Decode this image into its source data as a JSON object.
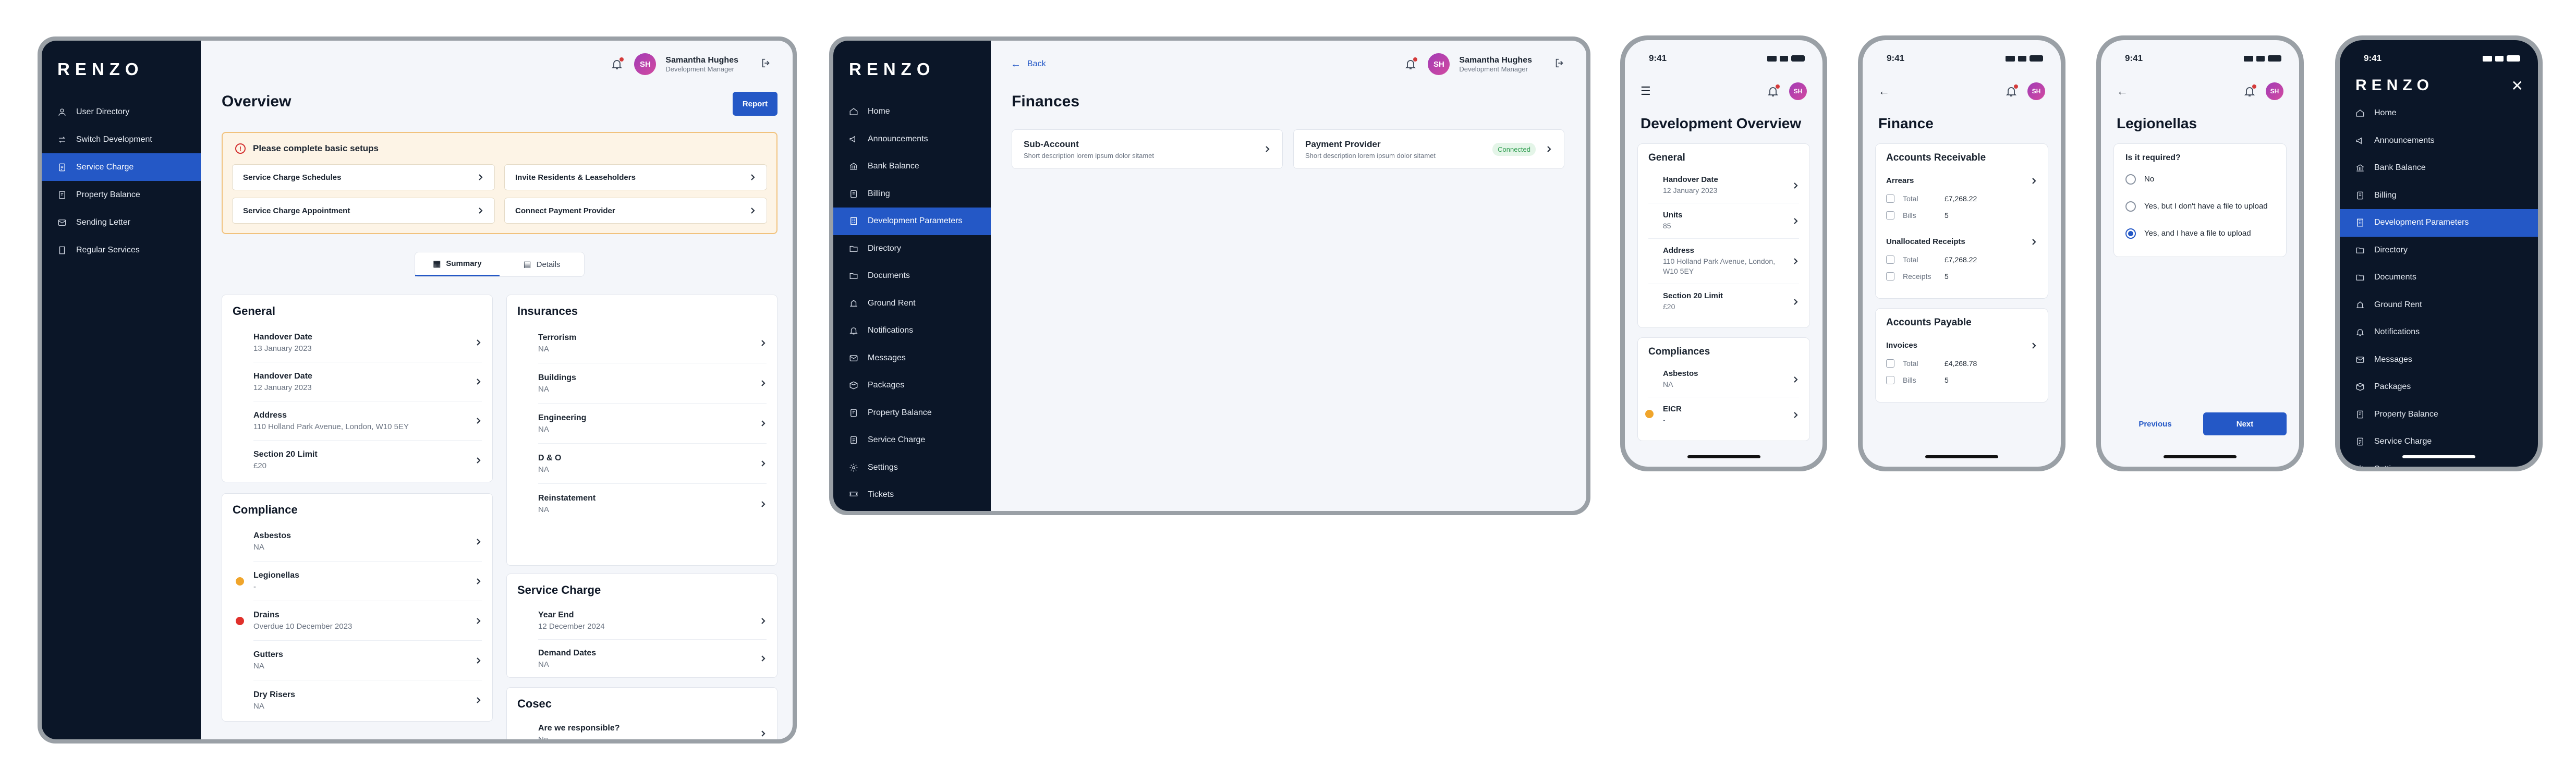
{
  "brand": {
    "logo": "RENZO"
  },
  "user": {
    "name": "Samantha Hughes",
    "role": "Development Manager",
    "initials": "SH"
  },
  "colors": {
    "sidebar": "#0b1628",
    "accent": "#2458c6",
    "warning": "#f0a52b",
    "error": "#e0302b",
    "success": "#2e9d4f"
  },
  "screen1": {
    "nav": [
      "User Directory",
      "Switch Development",
      "Service Charge",
      "Property Balance",
      "Sending Letter",
      "Regular Services"
    ],
    "active_nav": "Service Charge",
    "title": "Overview",
    "report_button": "Report",
    "alert": {
      "title": "Please complete basic setups",
      "items": [
        "Service Charge Schedules",
        "Invite Residents & Leaseholders",
        "Service Charge Appointment",
        "Connect Payment Provider"
      ]
    },
    "tabs": [
      "Summary",
      "Details"
    ],
    "active_tab": "Summary",
    "general": {
      "title": "General",
      "rows": [
        {
          "label": "Handover Date",
          "value": "13 January 2023"
        },
        {
          "label": "Handover Date",
          "value": "12 January 2023"
        },
        {
          "label": "Address",
          "value": "110 Holland Park Avenue, London, W10 5EY"
        },
        {
          "label": "Section 20 Limit",
          "value": "£20"
        }
      ]
    },
    "compliance": {
      "title": "Compliance",
      "rows": [
        {
          "label": "Asbestos",
          "value": "NA",
          "status": ""
        },
        {
          "label": "Legionellas",
          "value": "-",
          "status": "warning"
        },
        {
          "label": "Drains",
          "value": "Overdue 10 December 2023",
          "status": "error"
        },
        {
          "label": "Gutters",
          "value": "NA",
          "status": ""
        },
        {
          "label": "Dry Risers",
          "value": "NA",
          "status": ""
        }
      ]
    },
    "insurances": {
      "title": "Insurances",
      "rows": [
        {
          "label": "Terrorism",
          "value": "NA"
        },
        {
          "label": "Buildings",
          "value": "NA"
        },
        {
          "label": "Engineering",
          "value": "NA"
        },
        {
          "label": "D & O",
          "value": "NA"
        },
        {
          "label": "Reinstatement",
          "value": "NA"
        }
      ]
    },
    "service_charge": {
      "title": "Service Charge",
      "rows": [
        {
          "label": "Year End",
          "value": "12 December 2024"
        },
        {
          "label": "Demand Dates",
          "value": "NA"
        }
      ]
    },
    "cosec": {
      "title": "Cosec",
      "rows": [
        {
          "label": "Are we responsible?",
          "value": "No"
        }
      ]
    }
  },
  "screen2": {
    "nav": [
      "Home",
      "Announcements",
      "Bank Balance",
      "Billing",
      "Development Parameters",
      "Directory",
      "Documents",
      "Ground Rent",
      "Notifications",
      "Messages",
      "Packages",
      "Property Balance",
      "Service Charge",
      "Settings",
      "Tickets"
    ],
    "active_nav": "Development Parameters",
    "back": "Back",
    "title": "Finances",
    "cards": [
      {
        "title": "Sub-Account",
        "desc": "Short description lorem ipsum dolor sitamet",
        "badge": ""
      },
      {
        "title": "Payment Provider",
        "desc": "Short description lorem ipsum dolor sitamet",
        "badge": "Connected"
      }
    ]
  },
  "mobile_time": "9:41",
  "screen3": {
    "title": "Development Overview",
    "general": {
      "title": "General",
      "rows": [
        {
          "label": "Handover Date",
          "value": "12 January 2023"
        },
        {
          "label": "Units",
          "value": "85"
        },
        {
          "label": "Address",
          "value": "110 Holland Park Avenue, London, W10 5EY"
        },
        {
          "label": "Section 20 Limit",
          "value": "£20"
        }
      ]
    },
    "compliances": {
      "title": "Compliances",
      "rows": [
        {
          "label": "Asbestos",
          "value": "NA",
          "status": ""
        },
        {
          "label": "EICR",
          "value": "-",
          "status": "warning"
        }
      ]
    }
  },
  "screen4": {
    "title": "Finance",
    "receivable": {
      "title": "Accounts Receivable",
      "groups": [
        {
          "title": "Arrears",
          "lines": [
            {
              "label": "Total",
              "value": "£7,268.22"
            },
            {
              "label": "Bills",
              "value": "5"
            }
          ]
        },
        {
          "title": "Unallocated Receipts",
          "lines": [
            {
              "label": "Total",
              "value": "£7,268.22"
            },
            {
              "label": "Receipts",
              "value": "5"
            }
          ]
        }
      ]
    },
    "payable": {
      "title": "Accounts Payable",
      "groups": [
        {
          "title": "Invoices",
          "lines": [
            {
              "label": "Total",
              "value": "£4,268.78"
            },
            {
              "label": "Bills",
              "value": "5"
            }
          ]
        }
      ]
    }
  },
  "screen5": {
    "title": "Legionellas",
    "question": "Is it required?",
    "options": [
      "No",
      "Yes, but I don't have a file to upload",
      "Yes, and I have a file to upload"
    ],
    "selected": 2,
    "previous": "Previous",
    "next": "Next"
  },
  "screen6": {
    "nav": [
      "Home",
      "Announcements",
      "Bank Balance",
      "Billing",
      "Development Parameters",
      "Directory",
      "Documents",
      "Ground Rent",
      "Notifications",
      "Messages",
      "Packages",
      "Property Balance",
      "Service Charge",
      "Settings"
    ],
    "active_nav": "Development Parameters"
  }
}
